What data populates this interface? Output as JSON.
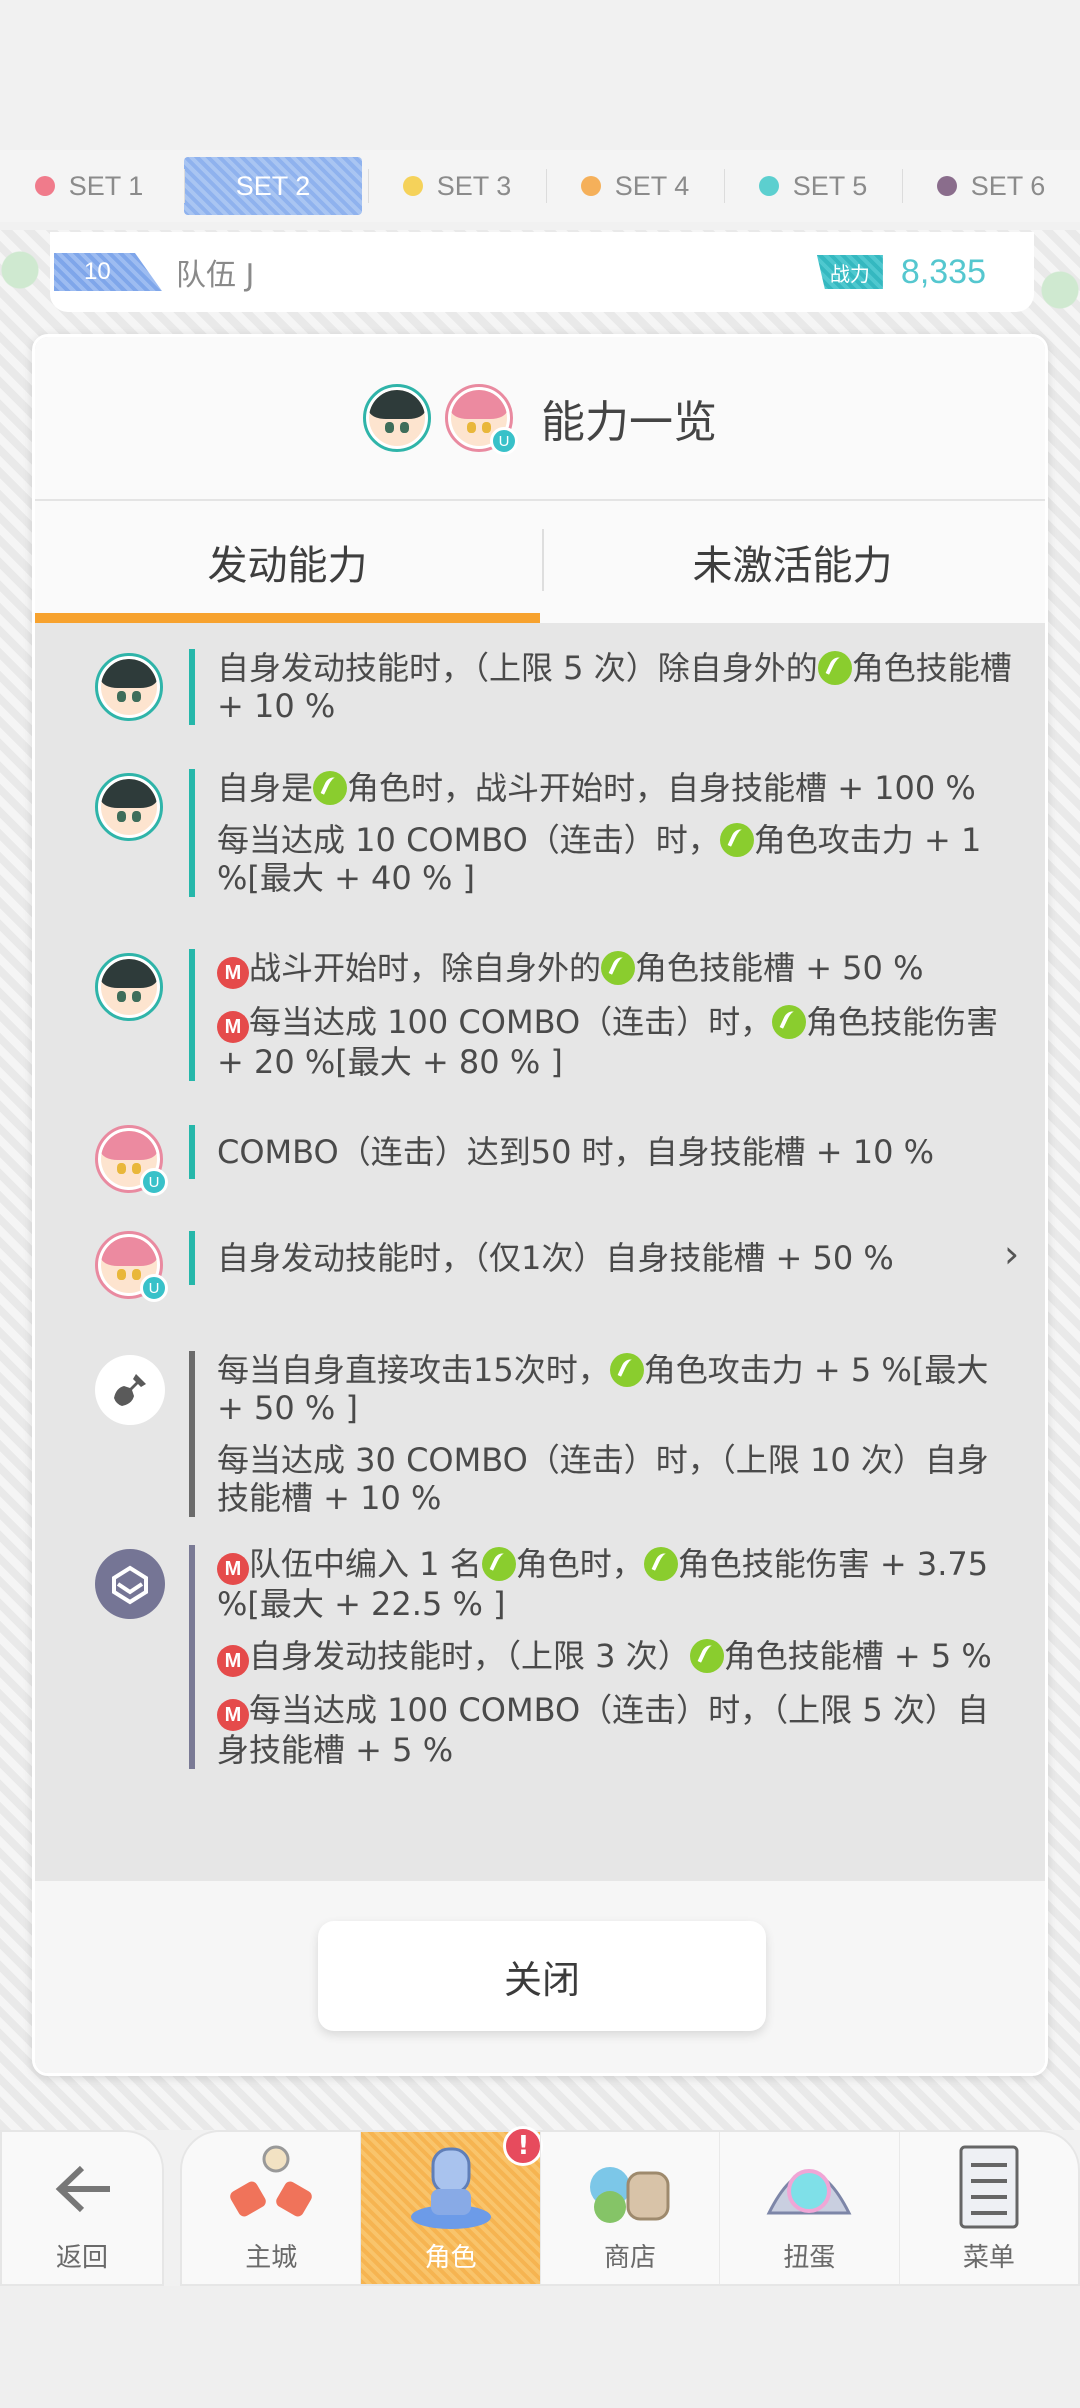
{
  "set_tabs": [
    {
      "label": "SET 1",
      "color": "#f07b8b"
    },
    {
      "label": "SET 2",
      "color": "#ffffff",
      "active": true
    },
    {
      "label": "SET 3",
      "color": "#f5d25a"
    },
    {
      "label": "SET 4",
      "color": "#f5b05a"
    },
    {
      "label": "SET 5",
      "color": "#5ccfcf"
    },
    {
      "label": "SET 6",
      "color": "#8a6d8c"
    }
  ],
  "team": {
    "number": "10",
    "name": "队伍 J",
    "power_label": "战力",
    "power_value": "8,335"
  },
  "modal": {
    "title": "能力一览",
    "tab_active": "发动能力",
    "tab_inactive": "未激活能力",
    "close_label": "关闭",
    "avatar_badge": "U"
  },
  "abilities": [
    {
      "lines": [
        "自身发动技能时，（上限 5 次）除自身外的[G]角色技能槽 + 10 %"
      ]
    },
    {
      "lines": [
        "自身是[G]角色时，战斗开始时，自身技能槽 + 100 %",
        "每当达成 10 COMBO（连击）时，[G]角色攻击力 + 1 %[最大 + 40 % ]"
      ]
    },
    {
      "lines": [
        "[M]战斗开始时，除自身外的[G]角色技能槽 + 50 %",
        "[M]每当达成 100 COMBO（连击）时，[G]角色技能伤害 + 20 %[最大 + 80 % ]"
      ]
    },
    {
      "lines": [
        "COMBO（连击）达到50 时，自身技能槽 + 10 %"
      ]
    },
    {
      "lines": [
        "自身发动技能时，（仅1次）自身技能槽 + 50 %"
      ]
    },
    {
      "lines": [
        "每当自身直接攻击15次时，[G]角色攻击力 + 5 %[最大 + 50 % ]",
        "每当达成 30 COMBO（连击）时，（上限 10 次）自身技能槽 + 10 %"
      ]
    },
    {
      "lines": [
        "[M]队伍中编入 1 名[G]角色时，[G]角色技能伤害 + 3.75 %[最大 + 22.5 % ]",
        "[M]自身发动技能时，（上限 3 次）[G]角色技能槽 + 5 %",
        "[M]每当达成 100 COMBO（连击）时，（上限 5 次）自身技能槽 + 5 %"
      ]
    }
  ],
  "m_badge": "M",
  "nav": {
    "back": "返回",
    "items": [
      "主城",
      "角色",
      "商店",
      "扭蛋",
      "菜单"
    ],
    "alert": "!"
  }
}
